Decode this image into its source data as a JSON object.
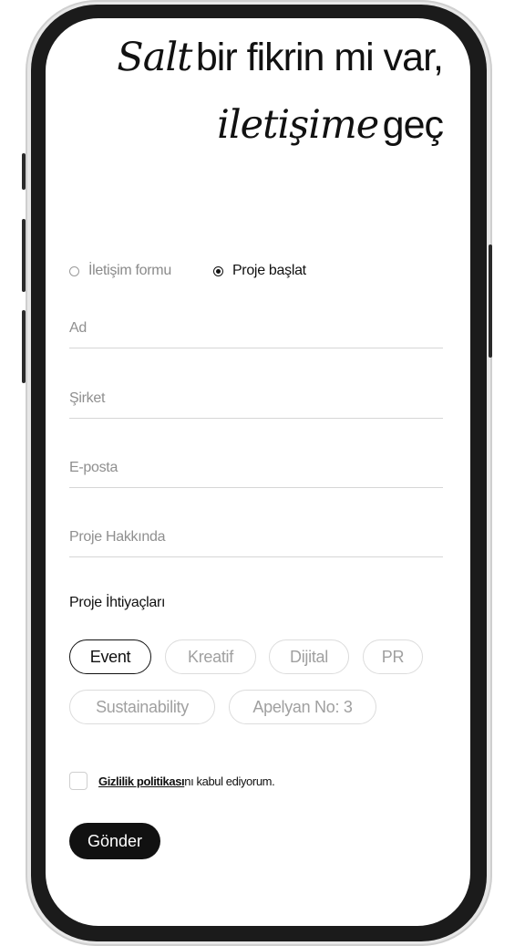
{
  "headline": {
    "line1_script": "Salt",
    "line1_plain": "bir fikrin mi var,",
    "line2_script": "iletişime",
    "line2_plain": "geç"
  },
  "form_type": {
    "options": [
      {
        "label": "İletişim formu",
        "selected": false
      },
      {
        "label": "Proje başlat",
        "selected": true
      }
    ]
  },
  "fields": {
    "name_placeholder": "Ad",
    "company_placeholder": "Şirket",
    "email_placeholder": "E-posta",
    "about_placeholder": "Proje Hakkında"
  },
  "needs": {
    "title": "Proje İhtiyaçları",
    "chips": [
      "Event",
      "Kreatif",
      "Dijital",
      "PR",
      "Sustainability",
      "Apelyan No: 3"
    ],
    "selected": "Event"
  },
  "consent": {
    "link_text": "Gizlilik politikası",
    "rest_text": "nı kabul ediyorum.",
    "checked": false
  },
  "submit_label": "Gönder",
  "colors": {
    "ink": "#111111",
    "muted": "#8f8f8f",
    "frame": "#1b1b1b"
  }
}
